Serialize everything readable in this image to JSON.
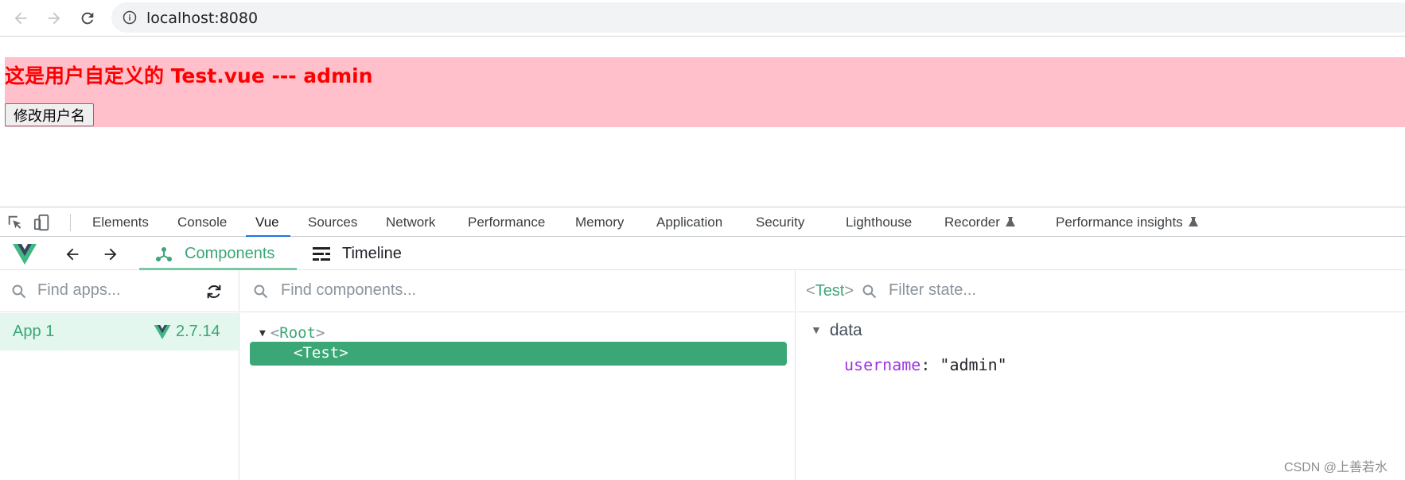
{
  "browser": {
    "url": "localhost:8080"
  },
  "page": {
    "title": "这是用户自定义的 Test.vue --- admin",
    "button_label": "修改用户名",
    "box_color": "#ffc0cb",
    "title_color": "#ff0000"
  },
  "devtools": {
    "tabs": [
      {
        "label": "Elements"
      },
      {
        "label": "Console"
      },
      {
        "label": "Vue"
      },
      {
        "label": "Sources"
      },
      {
        "label": "Network"
      },
      {
        "label": "Performance"
      },
      {
        "label": "Memory"
      },
      {
        "label": "Application"
      },
      {
        "label": "Security"
      },
      {
        "label": "Lighthouse"
      },
      {
        "label": "Recorder"
      },
      {
        "label": "Performance insights"
      }
    ],
    "active_tab": "Vue",
    "active_color": "#1a73e8"
  },
  "vue": {
    "nav_tabs": {
      "components": "Components",
      "timeline": "Timeline"
    },
    "accent": "#3ba776",
    "apps": {
      "search_placeholder": "Find apps...",
      "items": [
        {
          "name": "App 1",
          "version": "2.7.14"
        }
      ]
    },
    "tree": {
      "search_placeholder": "Find components...",
      "root": {
        "open": "<",
        "name": "Root",
        "close": ">"
      },
      "selected": "<Test>"
    },
    "state": {
      "tag": {
        "open": "<",
        "name": "Test",
        "close": ">"
      },
      "search_placeholder": "Filter state...",
      "section": "data",
      "props": [
        {
          "key": "username",
          "value": "\"admin\""
        }
      ]
    }
  },
  "watermark": "CSDN @上善若水"
}
